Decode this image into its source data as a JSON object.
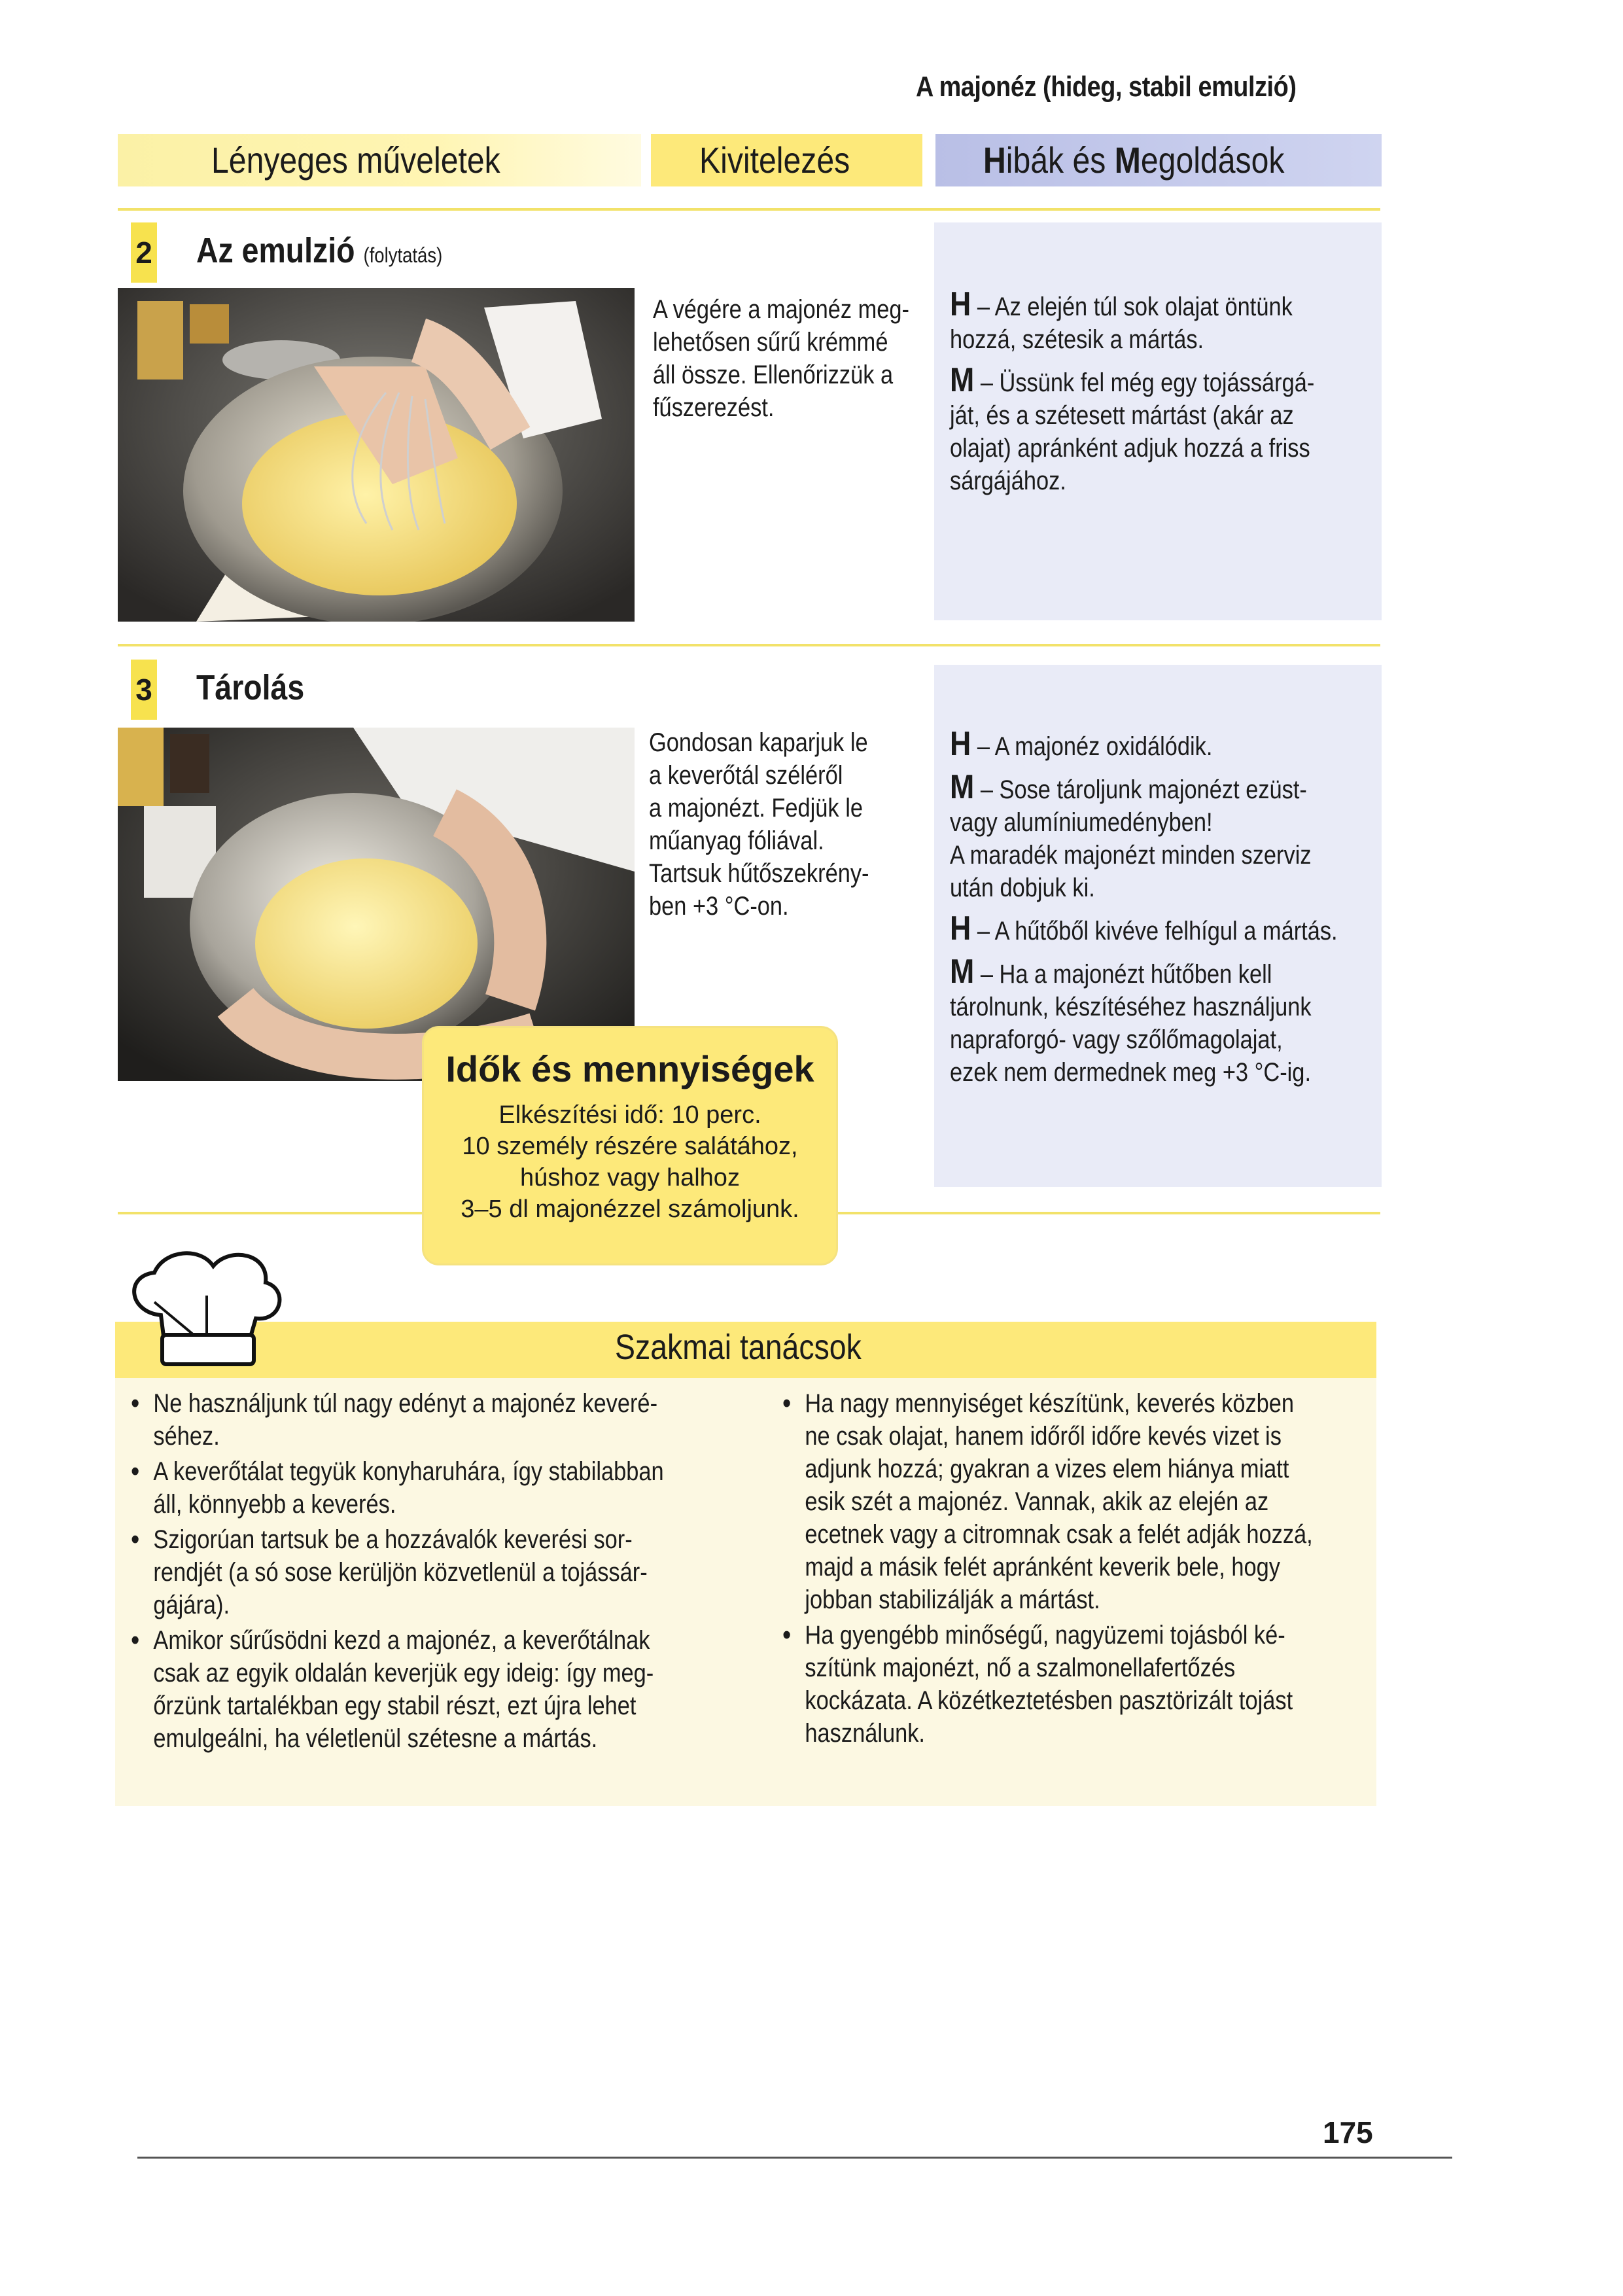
{
  "running_header": "A majonéz (hideg, stabil emulzió)",
  "columns": {
    "col1": "Lényeges műveletek",
    "col2": "Kivitelezés",
    "col3_bold1": "H",
    "col3_part1": "ibák és ",
    "col3_bold2": "M",
    "col3_part2": "egoldások"
  },
  "step2": {
    "number": "2",
    "title": "Az emulzió",
    "title_note": "(folytatás)",
    "description": [
      "A végére a majonéz meg-",
      "lehetősen sűrű krémmé",
      "áll össze. Ellenőrizzük a",
      "fűszerezést."
    ],
    "issues": [
      {
        "key": "H",
        "lines": [
          "– Az elején túl sok olajat öntünk",
          "hozzá, szétesik a mártás."
        ]
      },
      {
        "key": "M",
        "lines": [
          "– Üssünk fel még egy tojássárgá-",
          "ját, és a szétesett mártást (akár az",
          "olajat) apránként adjuk hozzá a friss",
          "sárgájához."
        ]
      }
    ]
  },
  "step3": {
    "number": "3",
    "title": "Tárolás",
    "description": [
      "Gondosan kaparjuk le",
      "a keverőtál széléről",
      "a majonézt. Fedjük le",
      "műanyag fóliával.",
      "Tartsuk hűtőszekrény-",
      "ben +3 °C-on."
    ],
    "issues": [
      {
        "key": "H",
        "lines": [
          "– A majonéz oxidálódik."
        ]
      },
      {
        "key": "M",
        "lines": [
          "– Sose tároljunk majonézt ezüst-",
          "vagy alumíniumedényben!",
          "A maradék majonézt minden szerviz",
          "után dobjuk ki."
        ]
      },
      {
        "key": "H",
        "lines": [
          "– A hűtőből kivéve felhígul a mártás."
        ]
      },
      {
        "key": "M",
        "lines": [
          "– Ha a majonézt hűtőben kell",
          "tárolnunk, készítéséhez használjunk",
          "napraforgó- vagy szőlőmagolajat,",
          "ezek nem dermednek meg +3 °C-ig."
        ]
      }
    ]
  },
  "timebox": {
    "title": "Idők és mennyiségek",
    "lines": [
      "Elkészítési idő: 10 perc.",
      "10 személy részére salátához,",
      "húshoz vagy halhoz",
      "3–5 dl majonézzel számoljunk."
    ]
  },
  "tips": {
    "title": "Szakmai tanácsok",
    "left": [
      [
        "Ne használjunk túl nagy edényt a majonéz keveré-",
        "séhez."
      ],
      [
        "A keverőtálat tegyük konyharuhára, így stabilabban",
        "áll, könnyebb a keverés."
      ],
      [
        "Szigorúan tartsuk be a hozzávalók keverési sor-",
        "rendjét (a só sose kerüljön közvetlenül a tojássár-",
        "gájára)."
      ],
      [
        "Amikor sűrűsödni kezd a majonéz, a keverőtálnak",
        "csak az egyik oldalán keverjük egy ideig: így meg-",
        "őrzünk tartalékban egy stabil részt, ezt újra lehet",
        "emulgeálni, ha véletlenül szétesne a mártás."
      ]
    ],
    "right": [
      [
        "Ha nagy mennyiséget készítünk, keverés közben",
        "ne csak olajat, hanem időről időre kevés vizet is",
        "adjunk hozzá; gyakran a vizes elem hiánya miatt",
        "esik szét a majonéz. Vannak, akik az elején az",
        "ecetnek vagy a citromnak csak a felét adják hozzá,",
        "majd a másik felét apránként keverik bele, hogy",
        "jobban stabilizálják a mártást."
      ],
      [
        "Ha gyengébb minőségű, nagyüzemi tojásból ké-",
        "szítünk majonézt, nő a szalmonellafertőzés",
        "kockázata. A közétkeztetésben pasztörizált tojást",
        "használunk."
      ]
    ]
  },
  "page_number": "175"
}
